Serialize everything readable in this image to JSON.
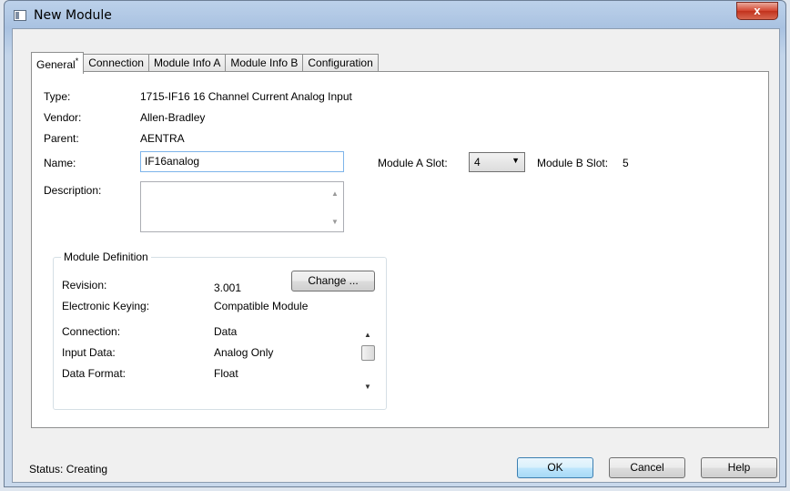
{
  "window": {
    "title": "New Module",
    "close_glyph": "x"
  },
  "tabs": [
    {
      "label": "General",
      "marker": "*"
    },
    {
      "label": "Connection"
    },
    {
      "label": "Module Info A"
    },
    {
      "label": "Module Info B"
    },
    {
      "label": "Configuration"
    }
  ],
  "general": {
    "type_label": "Type:",
    "type_value": "1715-IF16 16 Channel Current Analog Input",
    "vendor_label": "Vendor:",
    "vendor_value": "Allen-Bradley",
    "parent_label": "Parent:",
    "parent_value": "AENTRA",
    "name_label": "Name:",
    "name_value": "IF16analog",
    "description_label": "Description:",
    "description_value": "",
    "slot_a_label": "Module A Slot:",
    "slot_a_value": "4",
    "slot_b_label": "Module B Slot:",
    "slot_b_value": "5"
  },
  "module_definition": {
    "title": "Module Definition",
    "revision_label": "Revision:",
    "revision_value": "3.001",
    "change_button": "Change ...",
    "keying_label": "Electronic Keying:",
    "keying_value": "Compatible Module",
    "rows": [
      {
        "label": "Connection:",
        "value": "Data"
      },
      {
        "label": "Input Data:",
        "value": "Analog Only"
      },
      {
        "label": "Data Format:",
        "value": "Float"
      }
    ]
  },
  "footer": {
    "status_label": "Status:",
    "status_value": "Creating",
    "ok": "OK",
    "cancel": "Cancel",
    "help": "Help"
  },
  "icons": {
    "scroll_up": "▲",
    "scroll_down": "▼",
    "dropdown": "▼"
  }
}
